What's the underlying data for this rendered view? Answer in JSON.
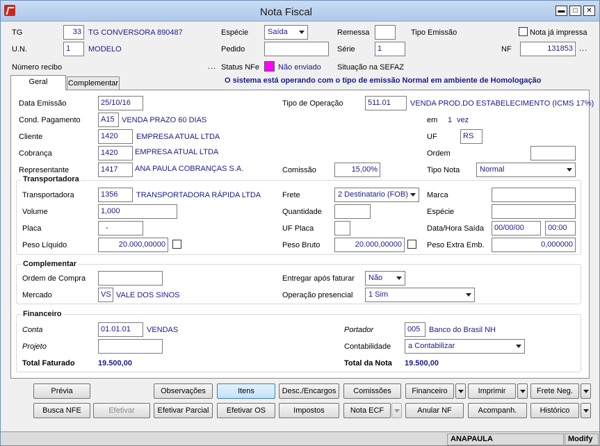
{
  "window": {
    "title": "Nota Fiscal",
    "minimize": "▬",
    "maximize": "□",
    "close": "✕"
  },
  "header": {
    "tg_label": "TG",
    "tg_value": "33",
    "tg_name": "TG CONVERSORA 890487",
    "un_label": "U.N.",
    "un_value": "1",
    "un_name": "MODELO",
    "especie_label": "Espécie",
    "especie_value": "Saída",
    "pedido_label": "Pedido",
    "pedido_value": "",
    "remessa_label": "Remessa",
    "remessa_value": "",
    "serie_label": "Série",
    "serie_value": "1",
    "tipo_emissao_label": "Tipo Emissão",
    "nota_impressa_label": "Nota já impressa",
    "nf_label": "NF",
    "nf_value": "131853",
    "numero_recibo_label": "Número recibo",
    "status_nfe_label": "Status NFe",
    "status_nfe_value": "Não enviado",
    "situacao_label": "Situação na SEFAZ",
    "dots": "...",
    "status_color": "#ff00ff"
  },
  "tabs": [
    {
      "label": "Geral"
    },
    {
      "label": "Complementar"
    }
  ],
  "banner": "O sistema está operando com o tipo de emissão Normal em ambiente de Homologação",
  "geral": {
    "data_emissao_label": "Data Emissão",
    "data_emissao_value": "25/10/16",
    "tipo_operacao_label": "Tipo de Operação",
    "tipo_operacao_value": "511.01",
    "tipo_operacao_desc": "VENDA PROD.DO ESTABELECIMENTO (ICMS 17%)",
    "cond_pag_label": "Cond. Pagamento",
    "cond_pag_value": "A15",
    "cond_pag_desc": "VENDA PRAZO 60 DIAS",
    "em_label": "em",
    "em_value": "1",
    "vez_label": "vez",
    "cliente_label": "Cliente",
    "cliente_value": "1420",
    "cliente_desc": "EMPRESA ATUAL LTDA",
    "uf_label": "UF",
    "uf_value": "RS",
    "cobranca_label": "Cobrança",
    "cobranca_value": "1420",
    "cobranca_desc": "EMPRESA ATUAL LTDA",
    "ordem_label": "Ordem",
    "ordem_value": "",
    "representante_label": "Representante",
    "representante_value": "1417",
    "representante_desc": "ANA PAULA COBRANÇAS S.A.",
    "comissao_label": "Comissão",
    "comissao_value": "15,00%",
    "tipo_nota_label": "Tipo Nota",
    "tipo_nota_value": "Normal"
  },
  "transportadora": {
    "title": "Transportadora",
    "transp_label": "Transportadora",
    "transp_value": "1356",
    "transp_desc": "TRANSPORTADORA RÁPIDA LTDA",
    "frete_label": "Frete",
    "frete_value": "2 Destinatario (FOB)",
    "marca_label": "Marca",
    "marca_value": "",
    "volume_label": "Volume",
    "volume_value": "1,000",
    "quantidade_label": "Quantidade",
    "quantidade_value": "",
    "especie_label": "Espécie",
    "especie_value": "",
    "placa_label": "Placa",
    "placa_value": "-",
    "uf_placa_label": "UF Placa",
    "uf_placa_value": "",
    "data_hora_label": "Data/Hora Saída",
    "data_value": "00/00/00",
    "hora_value": "00:00",
    "peso_liquido_label": "Peso Líquido",
    "peso_liquido_value": "20.000,00000",
    "peso_bruto_label": "Peso Bruto",
    "peso_bruto_value": "20.000,00000",
    "peso_extra_label": "Peso Extra Emb.",
    "peso_extra_value": "0,000000"
  },
  "complementar": {
    "title": "Complementar",
    "ordem_compra_label": "Ordem de Compra",
    "ordem_compra_value": "",
    "entregar_label": "Entregar após faturar",
    "entregar_value": "Não",
    "mercado_label": "Mercado",
    "mercado_value": "VS",
    "mercado_desc": "VALE DOS SINOS",
    "op_presencial_label": "Operação presencial",
    "op_presencial_value": "1 Sim"
  },
  "financeiro": {
    "title": "Financeiro",
    "conta_label": "Conta",
    "conta_value": "01.01.01",
    "conta_desc": "VENDAS",
    "portador_label": "Portador",
    "portador_value": "005",
    "portador_desc": "Banco do Brasil NH",
    "projeto_label": "Projeto",
    "projeto_value": "",
    "contabilidade_label": "Contabilidade",
    "contabilidade_value": "a Contabilizar",
    "total_faturado_label": "Total Faturado",
    "total_faturado_value": "19.500,00",
    "total_nota_label": "Total da Nota",
    "total_nota_value": "19.500,00"
  },
  "buttons": {
    "previa": "Prévia",
    "observacoes": "Observações",
    "itens": "Itens",
    "desc_encargos": "Desc./Encargos",
    "comissoes": "Comissões",
    "financeiro": "Financeiro",
    "imprimir": "Imprimir",
    "frete_neg": "Frete Neg.",
    "busca_nfe": "Busca NFE",
    "efetivar": "Efetivar",
    "efetivar_parcial": "Efetivar Parcial",
    "efetivar_os": "Efetivar OS",
    "impostos": "Impostos",
    "nota_ecf": "Nota ECF",
    "anular_nf": "Anular NF",
    "acompanh": "Acompanh.",
    "historico": "Histórico"
  },
  "statusbar": {
    "user": "ANAPAULA",
    "mode": "Modify"
  }
}
